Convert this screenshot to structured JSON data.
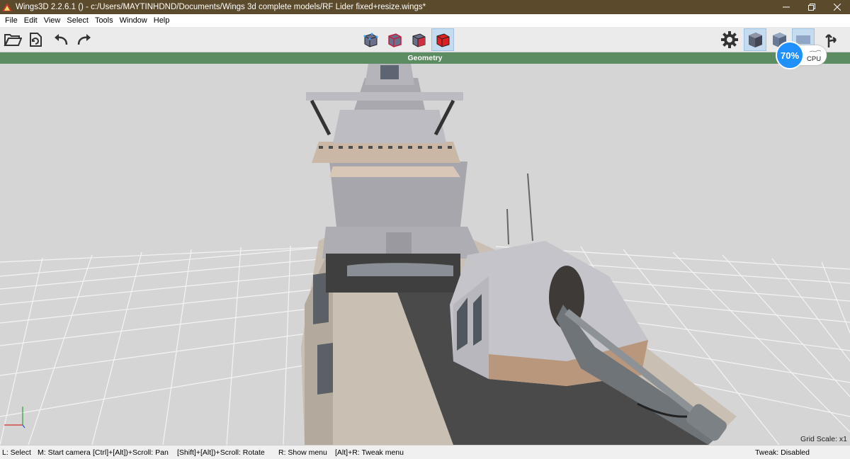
{
  "window": {
    "title": "Wings3D 2.2.6.1 () - c:/Users/MAYTINHDND/Documents/Wings 3d complete models/RF Lider fixed+resize.wings*",
    "controls": [
      "minimize",
      "restore",
      "close"
    ]
  },
  "menu": [
    "File",
    "Edit",
    "View",
    "Select",
    "Tools",
    "Window",
    "Help"
  ],
  "toolbar": {
    "left_icons": [
      "open-folder-icon",
      "save-icon",
      "undo-icon",
      "redo-icon"
    ],
    "selection_modes": [
      "vertex-mode-icon",
      "edge-mode-icon",
      "face-mode-icon",
      "object-mode-icon"
    ],
    "active_mode": "object-mode-icon",
    "right_icons": [
      "settings-gear-icon",
      "smooth-shaded-cube-icon",
      "flat-shaded-cube-icon",
      "wireframe-icon",
      "orthogonal-axes-icon"
    ]
  },
  "viewport": {
    "header": "Geometry",
    "grid_scale": "Grid Scale: x1"
  },
  "cpu": {
    "percent": "70%",
    "label": "CPU"
  },
  "status": {
    "hints": [
      "L: Select",
      "M: Start camera",
      "[Ctrl]+[Alt])+Scroll: Pan",
      "[Shift]+[Alt])+Scroll: Rotate",
      "R: Show menu",
      "[Alt]+R: Tweak menu"
    ],
    "tweak": "Tweak: Disabled"
  },
  "colors": {
    "titlebar": "#5b4a2b",
    "geometry_header": "#5c8c61",
    "viewport_bg": "#d5d5d5",
    "cpu_accent": "#1e90ff",
    "active_face_cube": "#e02020"
  }
}
